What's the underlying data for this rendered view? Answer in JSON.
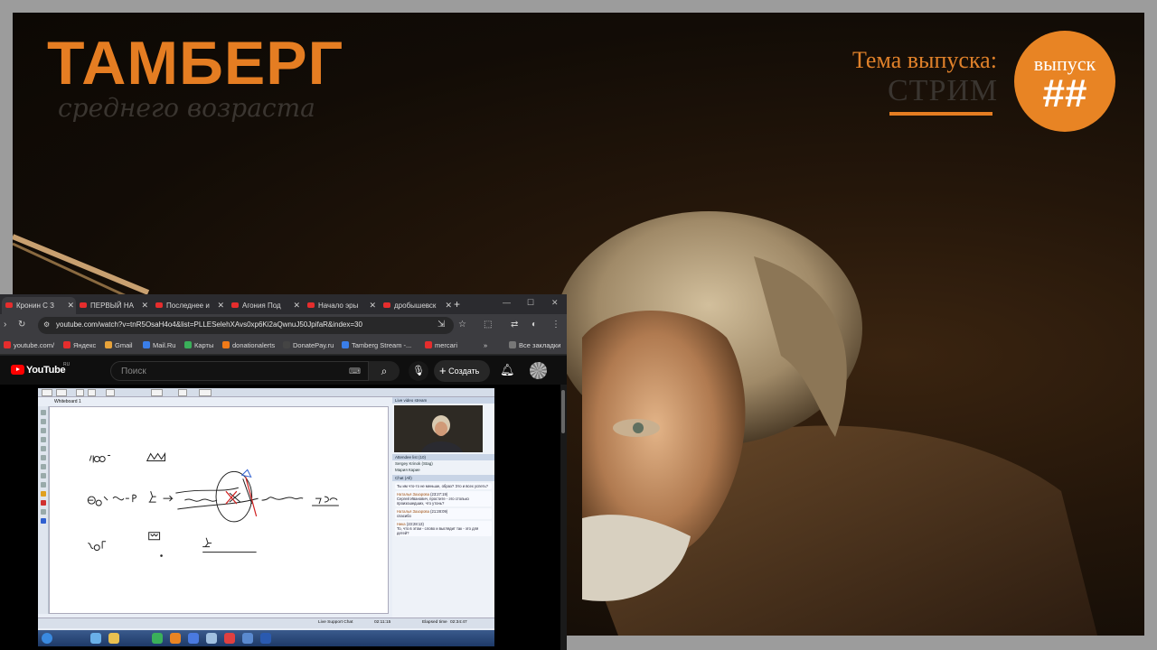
{
  "brand": {
    "title": "ТАМБЕРГ",
    "subtitle": "среднего возраста",
    "topic_label": "Тема выпуска:",
    "topic_value": "СТРИМ",
    "episode_label": "выпуск",
    "episode_number": "##",
    "accent_color": "#e57d22"
  },
  "browser": {
    "tabs": [
      {
        "label": "Кронин С З",
        "icon": "youtube-icon",
        "active": true
      },
      {
        "label": "ПЕРВЫЙ НА",
        "icon": "youtube-icon",
        "active": false
      },
      {
        "label": "Последнее и",
        "icon": "youtube-icon",
        "active": false
      },
      {
        "label": "Агония Под",
        "icon": "youtube-icon",
        "active": false
      },
      {
        "label": "Начало эры",
        "icon": "youtube-icon",
        "active": false
      },
      {
        "label": "дробышевск",
        "icon": "youtube-icon",
        "active": false
      }
    ],
    "new_tab": "+",
    "url": "youtube.com/watch?v=tnR5OsaH4o4&list=PLLESelehXAvs0xp6Ki2aQwnuJ50JpifaR&index=30",
    "bookmarks": [
      {
        "label": "youtube.com/",
        "color": "#e52d2d"
      },
      {
        "label": "Яндекс",
        "color": "#e52d2d"
      },
      {
        "label": "Gmail",
        "color": "#e8a33a"
      },
      {
        "label": "Mail.Ru",
        "color": "#3a7ee8"
      },
      {
        "label": "Карты",
        "color": "#3ab05a"
      },
      {
        "label": "donationalerts",
        "color": "#f07a18"
      },
      {
        "label": "DonatePay.ru",
        "color": "#444444"
      },
      {
        "label": "Tamberg Stream -...",
        "color": "#3a7ee8"
      },
      {
        "label": "mercari",
        "color": "#e52d2d"
      }
    ],
    "bookmarks_overflow": "»",
    "all_bookmarks": "Все закладки"
  },
  "youtube": {
    "logo": "YouTube",
    "region": "RU",
    "search_placeholder": "Поиск",
    "create_label": "Создать"
  },
  "video_app": {
    "whiteboard_tab": "Whiteboard 1",
    "side_video_title": "Live video stream",
    "attendee_title": "Attendee list (10)",
    "attendees": [
      "Sergey Krinok (Stag)",
      "Мария Карие"
    ],
    "chat_title": "Chat (All)",
    "chat_messages": [
      {
        "name": "",
        "time": "",
        "text": "Ты им что-то не меньше, образ? Это и всех успеть?"
      },
      {
        "name": "Наталья Захарова",
        "time": "(23:27:19)",
        "text": "Сергей Иванович, простите - это столько произошедших, что утонь?"
      },
      {
        "name": "Наталья Захарова",
        "time": "(21:28:09)",
        "text": "спасибо"
      },
      {
        "name": "Ника",
        "time": "(23:28:13)",
        "text": "То, что в этом - слово и выглядит так - это для детей?"
      }
    ],
    "status_live": "Live Support Chat",
    "status_time1": "02:11:15",
    "status_time2": "02:34:47",
    "status_elapsed_label": "Elapsed time"
  }
}
